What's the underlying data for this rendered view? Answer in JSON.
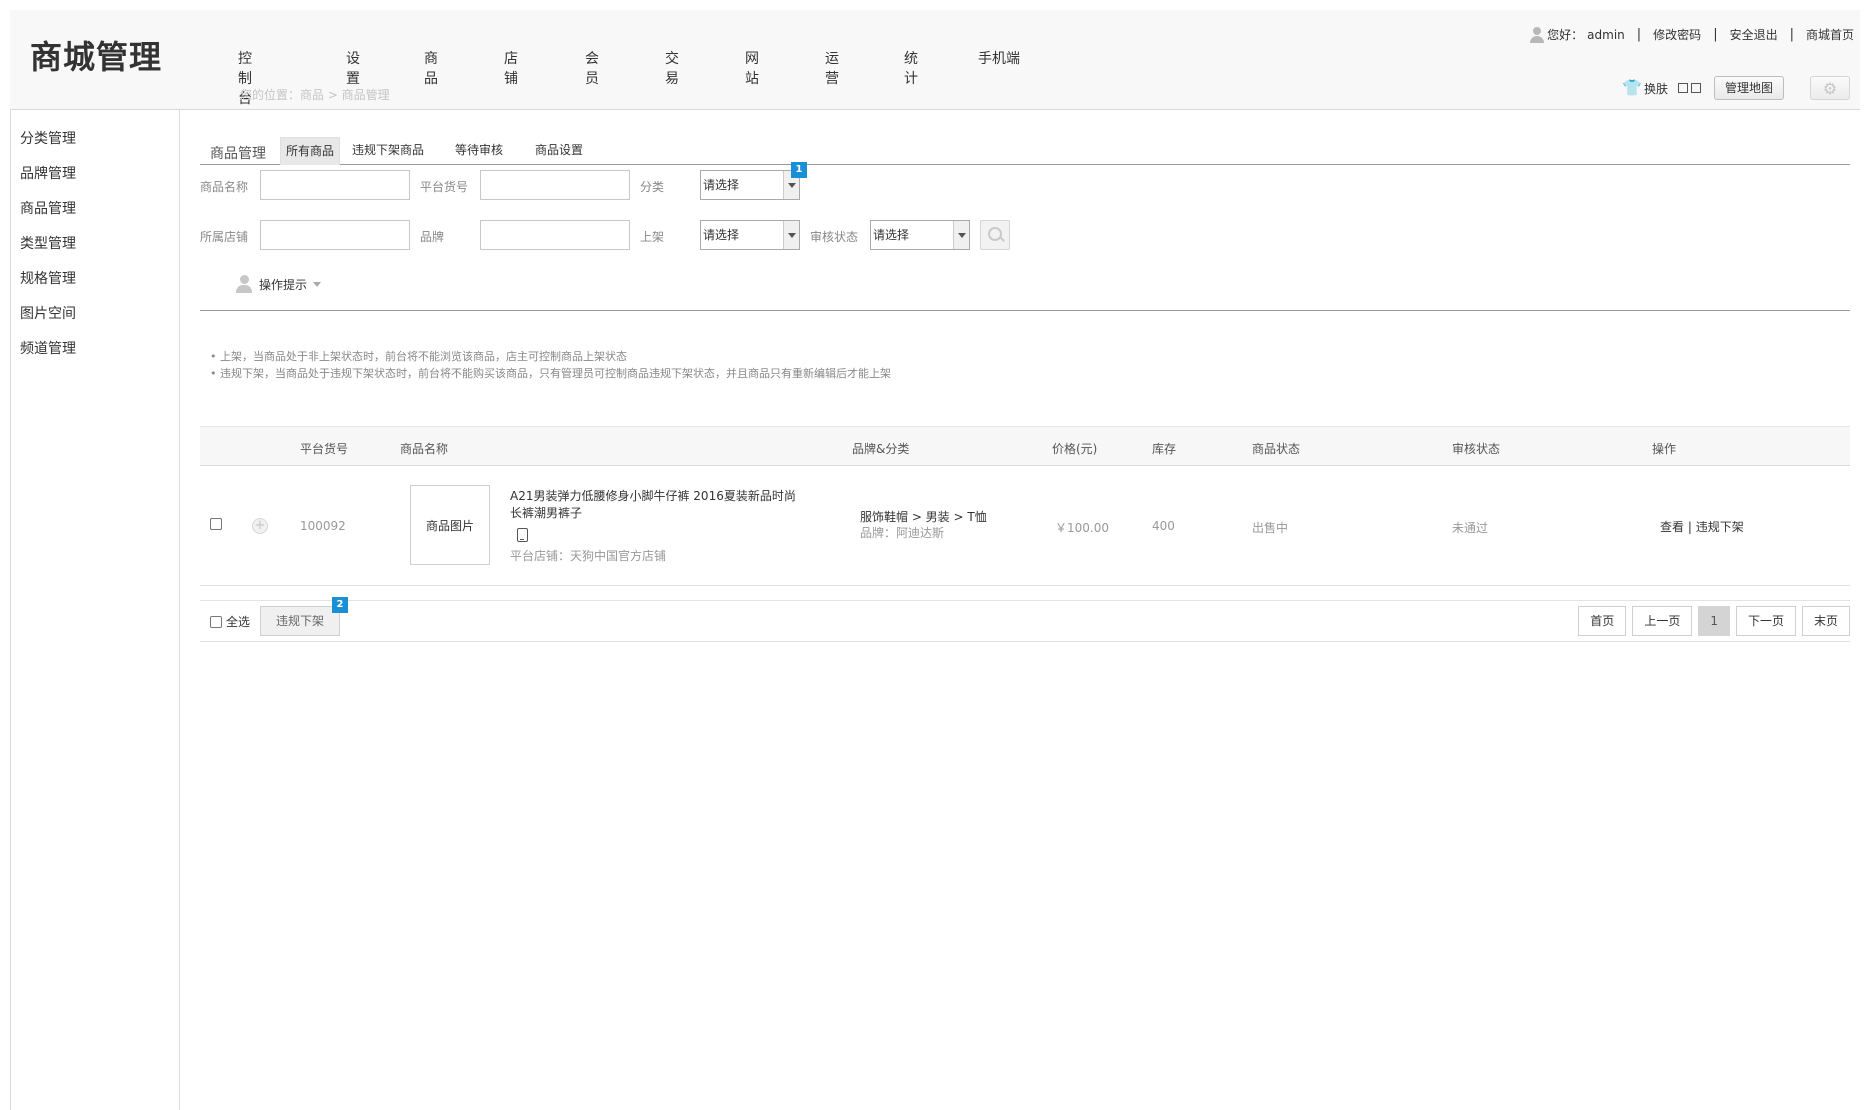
{
  "header": {
    "logo": "商城管理",
    "nav": [
      "控制台",
      "设置",
      "商品",
      "店铺",
      "会员",
      "交易",
      "网站",
      "运营",
      "统计",
      "手机端"
    ],
    "breadcrumb": "您的位置：商品 > 商品管理",
    "greeting": "您好：",
    "username": "admin",
    "change_password": "修改密码",
    "logout": "安全退出",
    "shop_home": "商城首页",
    "skin_label": "换肤",
    "admin_map": "管理地图"
  },
  "sidebar": {
    "items": [
      "分类管理",
      "品牌管理",
      "商品管理",
      "类型管理",
      "规格管理",
      "图片空间",
      "频道管理"
    ]
  },
  "tabs": {
    "title": "商品管理",
    "items": [
      "所有商品",
      "违规下架商品",
      "等待审核",
      "商品设置"
    ]
  },
  "filters": {
    "goods_name": "商品名称",
    "platform_sku": "平台货号",
    "category": "分类",
    "shop": "所属店铺",
    "brand": "品牌",
    "on_shelf": "上架",
    "audit_status": "审核状态",
    "select_placeholder": "请选择"
  },
  "badges": [
    "1",
    "2"
  ],
  "tips": {
    "toggle": "操作提示",
    "lines": [
      "• 上架，当商品处于非上架状态时，前台将不能浏览该商品，店主可控制商品上架状态",
      "• 违规下架，当商品处于违规下架状态时，前台将不能购买该商品，只有管理员可控制商品违规下架状态，并且商品只有重新编辑后才能上架"
    ]
  },
  "table": {
    "headers": [
      "平台货号",
      "商品名称",
      "品牌&分类",
      "价格(元)",
      "库存",
      "商品状态",
      "审核状态",
      "操作"
    ],
    "rows": [
      {
        "sku": "100092",
        "image": "商品图片",
        "name": "A21男装弹力低腰修身小脚牛仔裤 2016夏装新品时尚长裤潮男裤子",
        "shop": "平台店铺：天狗中国官方店铺",
        "category": "服饰鞋帽 > 男装 > T恤",
        "brand": "品牌：阿迪达斯",
        "price": "￥100.00",
        "stock": "400",
        "status": "出售中",
        "audit": "未通过",
        "op_view": "查看",
        "op_sep": " | ",
        "op_offline": "违规下架"
      }
    ]
  },
  "footer": {
    "select_all": "全选",
    "offline_button": "违规下架",
    "pager": {
      "first": "首页",
      "prev": "上一页",
      "current": "1",
      "next": "下一页",
      "last": "末页"
    }
  }
}
